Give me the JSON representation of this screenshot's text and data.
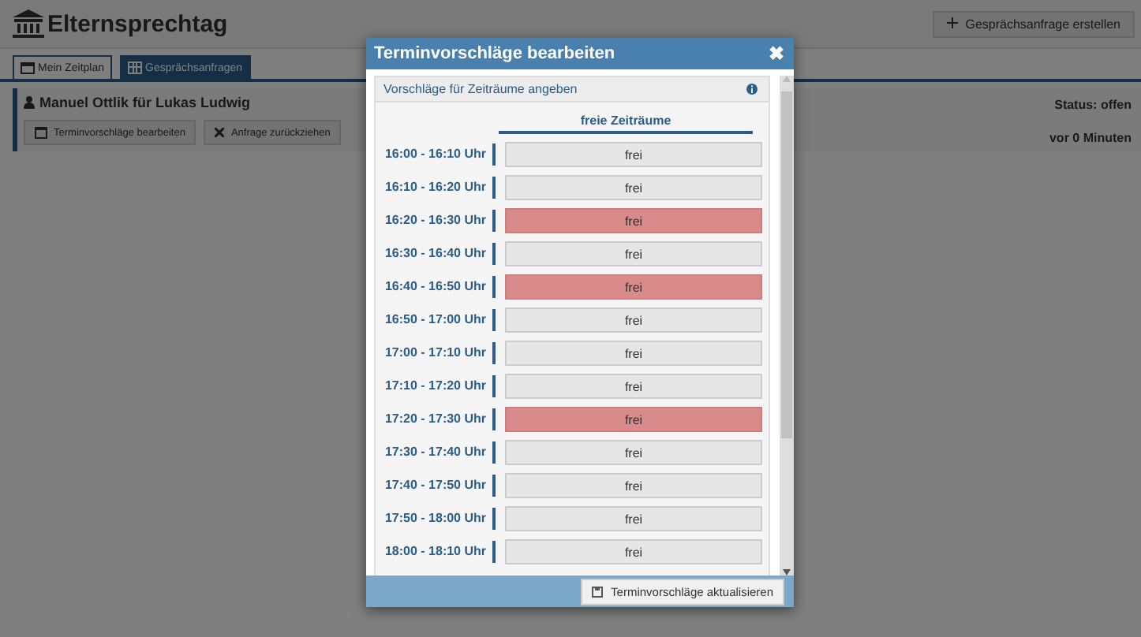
{
  "app": {
    "title": "Elternsprechtag",
    "create_button": "Gesprächsanfrage erstellen"
  },
  "tabs": [
    {
      "label": "Mein Zeitplan",
      "selected": false
    },
    {
      "label": "Gesprächsanfragen",
      "selected": true
    }
  ],
  "request": {
    "title": "Manuel Ottlik  für Lukas Ludwig",
    "status": "Status: offen",
    "time": "vor 0 Minuten",
    "buttons": [
      "Terminvorschläge bearbeiten",
      "Anfrage zurückziehen"
    ]
  },
  "modal": {
    "title": "Terminvorschläge bearbeiten",
    "close": "✖",
    "panel_title": "Vorschläge für Zeiträume angeben",
    "column_header": "freie Zeiträume",
    "save_button": "Terminvorschläge aktualisieren",
    "slots": [
      {
        "time": "16:00 - 16:10 Uhr",
        "label": "frei",
        "selected": false
      },
      {
        "time": "16:10 - 16:20 Uhr",
        "label": "frei",
        "selected": false
      },
      {
        "time": "16:20 - 16:30 Uhr",
        "label": "frei",
        "selected": true
      },
      {
        "time": "16:30 - 16:40 Uhr",
        "label": "frei",
        "selected": false
      },
      {
        "time": "16:40 - 16:50 Uhr",
        "label": "frei",
        "selected": true
      },
      {
        "time": "16:50 - 17:00 Uhr",
        "label": "frei",
        "selected": false
      },
      {
        "time": "17:00 - 17:10 Uhr",
        "label": "frei",
        "selected": false
      },
      {
        "time": "17:10 - 17:20 Uhr",
        "label": "frei",
        "selected": false
      },
      {
        "time": "17:20 - 17:30 Uhr",
        "label": "frei",
        "selected": true
      },
      {
        "time": "17:30 - 17:40 Uhr",
        "label": "frei",
        "selected": false
      },
      {
        "time": "17:40 - 17:50 Uhr",
        "label": "frei",
        "selected": false
      },
      {
        "time": "17:50 - 18:00 Uhr",
        "label": "frei",
        "selected": false
      },
      {
        "time": "18:00 - 18:10 Uhr",
        "label": "frei",
        "selected": false
      }
    ]
  }
}
